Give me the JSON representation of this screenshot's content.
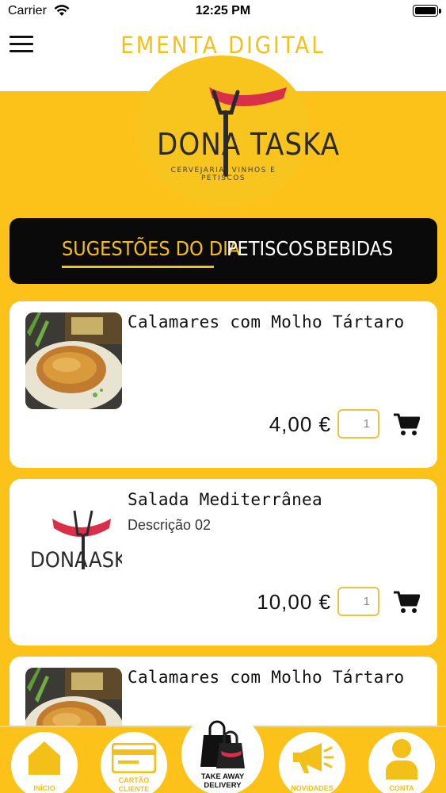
{
  "status_bar": {
    "carrier": "Carrier",
    "time": "12:25 PM"
  },
  "header": {
    "title": "EMENTA DIGITAL"
  },
  "logo": {
    "name": "DONA TASKA",
    "tagline": "CERVEJARIA, VINHOS E PETISCOS"
  },
  "tabs": [
    {
      "label": "SUGESTÕES DO DIA",
      "active": true
    },
    {
      "label": "PETISCOS",
      "active": false
    },
    {
      "label": "BEBIDAS",
      "active": false
    }
  ],
  "products": [
    {
      "name": "Calamares com Molho Tártaro",
      "description": "",
      "price": "4,00 €",
      "quantity": "1",
      "image": "food-photo"
    },
    {
      "name": "Salada Mediterrânea",
      "description": "Descrição 02",
      "price": "10,00 €",
      "quantity": "1",
      "image": "dona-taska-logo"
    },
    {
      "name": "Calamares com Molho Tártaro",
      "description": "",
      "price": "",
      "quantity": "",
      "image": "food-photo"
    }
  ],
  "bottom_nav": [
    {
      "label": "INÍCIO",
      "icon": "home-icon"
    },
    {
      "label": "CARTÃO CLIENTE",
      "line1": "CARTÃO",
      "line2": "CLIENTE",
      "icon": "card-icon"
    },
    {
      "label": "TAKE AWAY DELIVERY",
      "line1": "TAKE AWAY",
      "line2": "DELIVERY",
      "icon": "shopping-bags-icon"
    },
    {
      "label": "NOVIDADES",
      "icon": "megaphone-icon"
    },
    {
      "label": "CONTA",
      "icon": "user-icon"
    }
  ],
  "colors": {
    "accent": "#F3C01A",
    "background": "#FDC21A",
    "dark": "#0A0A0A",
    "brand_red": "#D8304A"
  }
}
